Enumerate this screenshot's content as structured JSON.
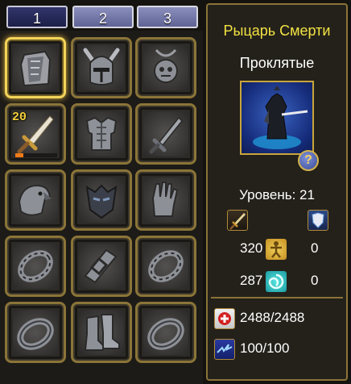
{
  "tabs": [
    {
      "label": "1",
      "active": true
    },
    {
      "label": "2",
      "active": false
    },
    {
      "label": "3",
      "active": false
    }
  ],
  "equipment_slots": [
    {
      "item": "cloak-icon"
    },
    {
      "item": "horned-helmet-icon"
    },
    {
      "item": "amulet-icon"
    },
    {
      "item": "sword-icon",
      "level_badge": "20",
      "durability": 0.2
    },
    {
      "item": "chest-armor-icon"
    },
    {
      "item": "offhand-sword-icon"
    },
    {
      "item": "eagle-pauldron-icon"
    },
    {
      "item": "dark-mask-icon"
    },
    {
      "item": "gauntlet-icon"
    },
    {
      "item": "chain-bracelet-icon"
    },
    {
      "item": "belt-icon"
    },
    {
      "item": "chain-bracelet-icon"
    },
    {
      "item": "ring-icon"
    },
    {
      "item": "boots-icon"
    },
    {
      "item": "ring-icon"
    }
  ],
  "character": {
    "name": "Рыцарь Смерти",
    "class_name": "Проклятые",
    "level_text": "Уровень: 21"
  },
  "stats": {
    "attack_value": "320",
    "defense_value": "287",
    "strength_value": "0",
    "magic_value": "0"
  },
  "resources": {
    "health": "2488/2488",
    "mana": "100/100"
  },
  "colors": {
    "title": "#f3e243",
    "frame": "#8a7438",
    "selected_frame": "#f3d45a",
    "durability": "#ef7a19"
  }
}
